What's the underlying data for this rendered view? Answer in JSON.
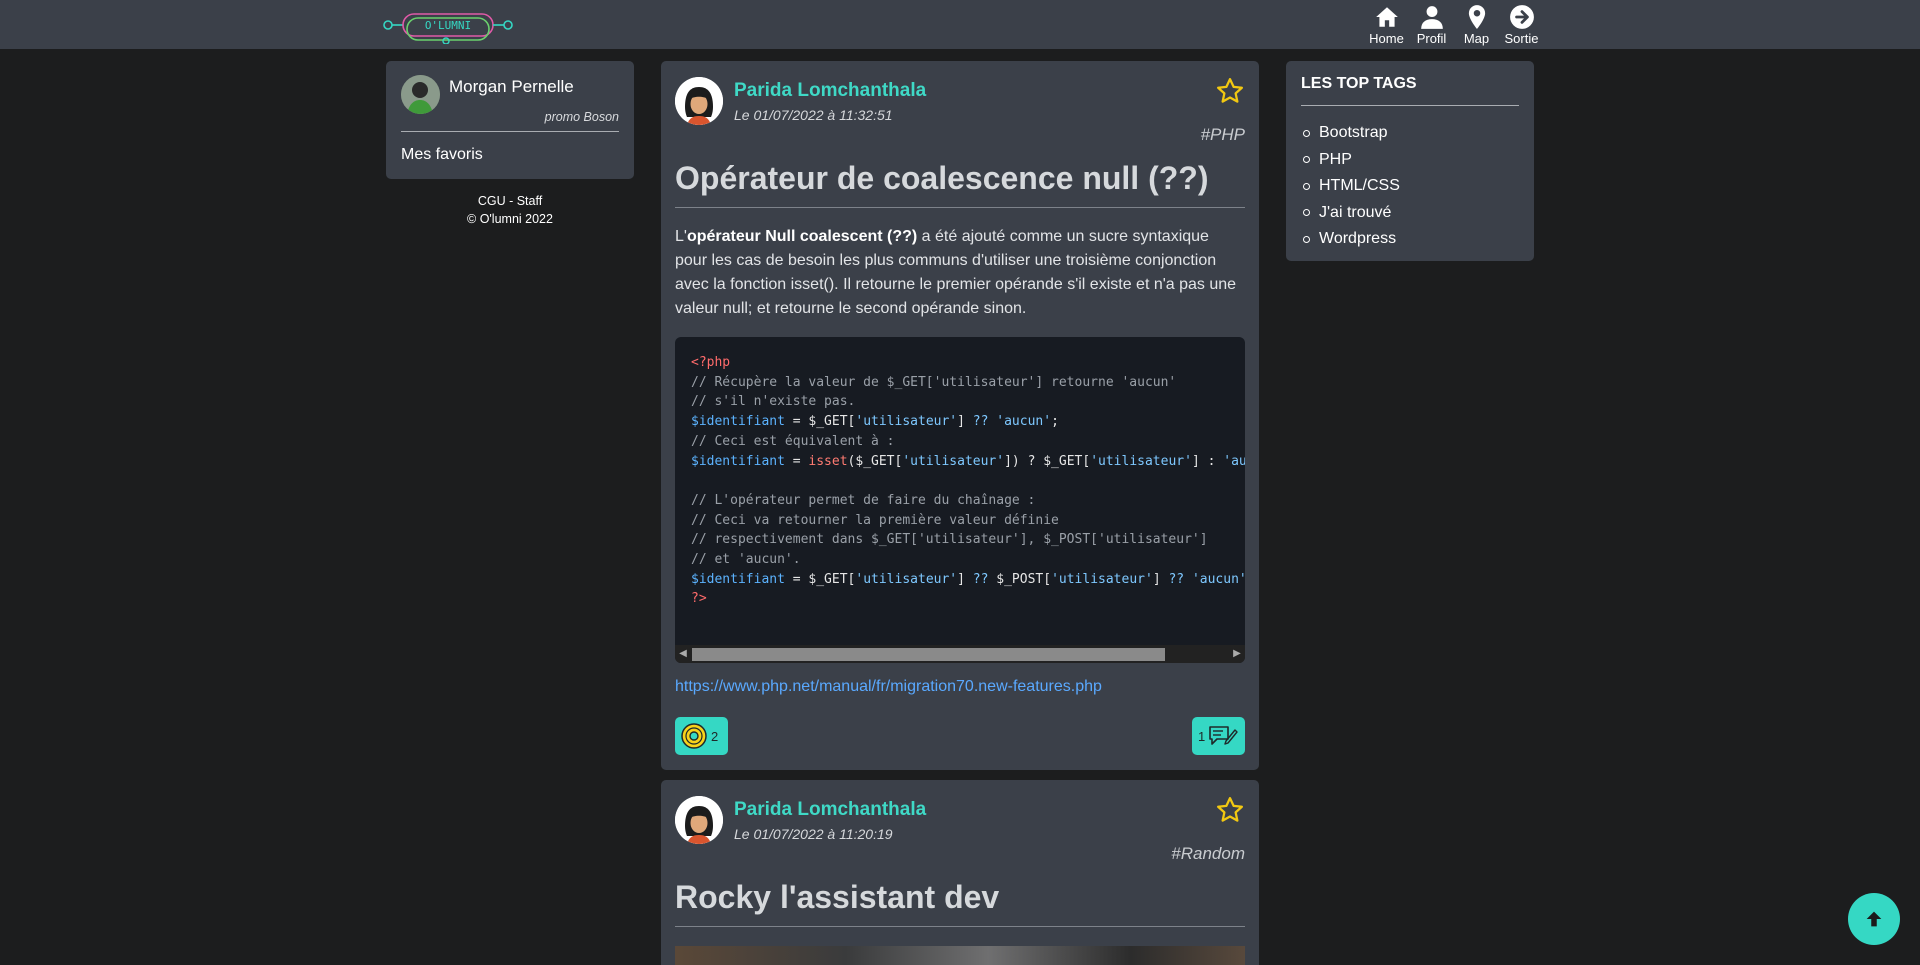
{
  "nav": {
    "logo_alt": "O'LUMNI",
    "links": [
      {
        "label": "Home",
        "icon": "home-icon"
      },
      {
        "label": "Profil",
        "icon": "user-icon"
      },
      {
        "label": "Map",
        "icon": "map-pin-icon"
      },
      {
        "label": "Sortie",
        "icon": "logout-icon"
      }
    ]
  },
  "profile": {
    "name": "Morgan Pernelle",
    "promo": "promo Boson",
    "favorites_label": "Mes favoris"
  },
  "footer": {
    "links": "CGU - Staff",
    "copyright": "© O'lumni 2022"
  },
  "posts": [
    {
      "author": "Parida Lomchanthala",
      "date": "Le 01/07/2022 à 11:32:51",
      "tag": "#PHP",
      "title": "Opérateur de coalescence null (??)",
      "body_prefix": "L'",
      "body_bold": "opérateur Null coalescent (??)",
      "body_rest": " a été ajouté comme un sucre syntaxique pour les cas de besoin les plus communs d'utiliser une troisième conjonction avec la fonction isset(). Il retourne le premier opérande s'il existe et n'a pas une valeur null; et retourne le second opérande sinon.",
      "link": "https://www.php.net/manual/fr/migration70.new-features.php",
      "likes": "2",
      "comments": "1"
    },
    {
      "author": "Parida Lomchanthala",
      "date": "Le 01/07/2022 à 11:20:19",
      "tag": "#Random",
      "title": "Rocky l'assistant dev"
    }
  ],
  "tags": {
    "title": "LES TOP TAGS",
    "items": [
      "Bootstrap",
      "PHP",
      "HTML/CSS",
      "J'ai trouvé",
      "Wordpress"
    ]
  },
  "colors": {
    "accent": "#35d8c4",
    "card": "#3b4049",
    "background": "#1c1d1e",
    "star": "#f2c811"
  }
}
